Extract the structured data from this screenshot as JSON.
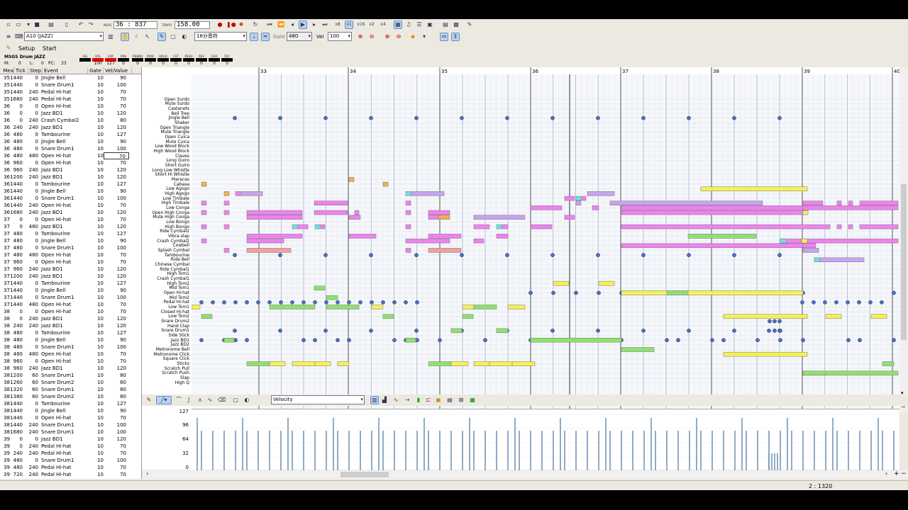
{
  "transport": {
    "meas_label": "MEAS",
    "position": "36 : 837",
    "tempo_label": "TEMPO",
    "tempo": "158.00",
    "zoom_x8": "x8",
    "zoom_x1": "x1",
    "zoom_x16": "x16",
    "zoom_x2": "x2",
    "zoom_x4": "x4"
  },
  "toolbar2": {
    "instrument": "A10 (JAZZ)",
    "grid": "16分音符",
    "gate_label": "Gate",
    "gate": "480",
    "vel_label": "Vel",
    "vel": "100"
  },
  "tabs": {
    "setup": "Setup",
    "start": "Start"
  },
  "mixer": {
    "track_name": "MSGS Drum JAZZ",
    "m_label": "M:",
    "m_value": "0",
    "l_label": "L:",
    "l_value": "0",
    "pc_label": "PC:",
    "pc_value": "33",
    "params": [
      {
        "label": "VEL",
        "value": ""
      },
      {
        "label": "VOL",
        "value": "100"
      },
      {
        "label": "EXP",
        "value": "127"
      },
      {
        "label": "PAN",
        "value": "0"
      },
      {
        "label": "P.BEND",
        "value": "0"
      },
      {
        "label": "MOD",
        "value": "0"
      },
      {
        "label": "HOLD",
        "value": "0"
      },
      {
        "label": "CUT",
        "value": "0"
      },
      {
        "label": "RESO",
        "value": "0"
      },
      {
        "label": "REV",
        "value": "0"
      },
      {
        "label": "CHO",
        "value": "0"
      },
      {
        "label": "DLY",
        "value": "0"
      }
    ]
  },
  "event_headers": [
    "Mea",
    "Tick",
    "Step",
    "Event",
    "Gate",
    "Vel/Value"
  ],
  "events": [
    [
      "35",
      "1440",
      "0",
      "Jingle Bell",
      "10",
      "90"
    ],
    [
      "35",
      "1440",
      "0",
      "Snare Drum1",
      "10",
      "100"
    ],
    [
      "35",
      "1440",
      "240",
      "Pedal Hi-hat",
      "10",
      "70"
    ],
    [
      "35",
      "1680",
      "240",
      "Pedal Hi-hat",
      "10",
      "70"
    ],
    [
      "36",
      "0",
      "0",
      "Open Hi-hat",
      "10",
      "70"
    ],
    [
      "36",
      "0",
      "0",
      "Jazz BD1",
      "10",
      "120"
    ],
    [
      "36",
      "0",
      "240",
      "Crash Cymbal2",
      "10",
      "80"
    ],
    [
      "36",
      "240",
      "240",
      "Jazz BD1",
      "10",
      "120"
    ],
    [
      "36",
      "480",
      "0",
      "Tambourine",
      "10",
      "127"
    ],
    [
      "36",
      "480",
      "0",
      "Jingle Bell",
      "10",
      "90"
    ],
    [
      "36",
      "480",
      "0",
      "Snare Drum1",
      "10",
      "100"
    ],
    [
      "36",
      "480",
      "480",
      "Open Hi-hat",
      "10",
      "70"
    ],
    [
      "36",
      "960",
      "0",
      "Open Hi-hat",
      "10",
      "70"
    ],
    [
      "36",
      "960",
      "240",
      "Jazz BD1",
      "10",
      "120"
    ],
    [
      "36",
      "1200",
      "240",
      "Jazz BD1",
      "10",
      "120"
    ],
    [
      "36",
      "1440",
      "0",
      "Tambourine",
      "10",
      "127"
    ],
    [
      "36",
      "1440",
      "0",
      "Jingle Bell",
      "10",
      "90"
    ],
    [
      "36",
      "1440",
      "0",
      "Snare Drum1",
      "10",
      "100"
    ],
    [
      "36",
      "1440",
      "240",
      "Open Hi-hat",
      "10",
      "70"
    ],
    [
      "36",
      "1680",
      "240",
      "Jazz BD1",
      "10",
      "120"
    ],
    [
      "37",
      "0",
      "0",
      "Open Hi-hat",
      "10",
      "70"
    ],
    [
      "37",
      "0",
      "480",
      "Jazz BD1",
      "10",
      "120"
    ],
    [
      "37",
      "480",
      "0",
      "Tambourine",
      "10",
      "127"
    ],
    [
      "37",
      "480",
      "0",
      "Jingle Bell",
      "10",
      "90"
    ],
    [
      "37",
      "480",
      "0",
      "Snare Drum1",
      "10",
      "100"
    ],
    [
      "37",
      "480",
      "480",
      "Open Hi-hat",
      "10",
      "70"
    ],
    [
      "37",
      "960",
      "0",
      "Open Hi-hat",
      "10",
      "70"
    ],
    [
      "37",
      "960",
      "240",
      "Jazz BD1",
      "10",
      "120"
    ],
    [
      "37",
      "1200",
      "240",
      "Jazz BD1",
      "10",
      "120"
    ],
    [
      "37",
      "1440",
      "0",
      "Tambourine",
      "10",
      "127"
    ],
    [
      "37",
      "1440",
      "0",
      "Jingle Bell",
      "10",
      "90"
    ],
    [
      "37",
      "1440",
      "0",
      "Snare Drum1",
      "10",
      "100"
    ],
    [
      "37",
      "1440",
      "480",
      "Open Hi-hat",
      "10",
      "70"
    ],
    [
      "38",
      "0",
      "0",
      "Open Hi-hat",
      "10",
      "70"
    ],
    [
      "38",
      "0",
      "240",
      "Jazz BD1",
      "10",
      "120"
    ],
    [
      "38",
      "240",
      "240",
      "Jazz BD1",
      "10",
      "120"
    ],
    [
      "38",
      "480",
      "0",
      "Tambourine",
      "10",
      "127"
    ],
    [
      "38",
      "480",
      "0",
      "Jingle Bell",
      "10",
      "90"
    ],
    [
      "38",
      "480",
      "0",
      "Snare Drum1",
      "10",
      "100"
    ],
    [
      "38",
      "480",
      "480",
      "Open Hi-hat",
      "10",
      "70"
    ],
    [
      "38",
      "960",
      "0",
      "Open Hi-hat",
      "10",
      "70"
    ],
    [
      "38",
      "960",
      "240",
      "Jazz BD1",
      "10",
      "120"
    ],
    [
      "38",
      "1200",
      "60",
      "Snare Drum1",
      "10",
      "80"
    ],
    [
      "38",
      "1260",
      "60",
      "Snare Drum2",
      "10",
      "80"
    ],
    [
      "38",
      "1320",
      "60",
      "Snare Drum1",
      "10",
      "80"
    ],
    [
      "38",
      "1380",
      "60",
      "Snare Drum2",
      "10",
      "80"
    ],
    [
      "38",
      "1440",
      "0",
      "Tambourine",
      "10",
      "127"
    ],
    [
      "38",
      "1440",
      "0",
      "Jingle Bell",
      "10",
      "90"
    ],
    [
      "38",
      "1440",
      "0",
      "Open Hi-hat",
      "10",
      "70"
    ],
    [
      "38",
      "1440",
      "240",
      "Snare Drum1",
      "10",
      "100"
    ],
    [
      "38",
      "1680",
      "240",
      "Snare Drum1",
      "10",
      "100"
    ],
    [
      "39",
      "0",
      "0",
      "Jazz BD1",
      "10",
      "120"
    ],
    [
      "39",
      "0",
      "240",
      "Pedal Hi-hat",
      "10",
      "70"
    ],
    [
      "39",
      "240",
      "240",
      "Pedal Hi-hat",
      "10",
      "70"
    ],
    [
      "39",
      "480",
      "0",
      "Snare Drum1",
      "10",
      "100"
    ],
    [
      "39",
      "480",
      "240",
      "Pedal Hi-hat",
      "10",
      "70"
    ],
    [
      "39",
      "720",
      "240",
      "Pedal Hi-hat",
      "10",
      "70"
    ]
  ],
  "drum_names": [
    "Open Surdo",
    "Mute Surdo",
    "Castanets",
    "Bell Tree",
    "Jingle Bell",
    "Shaker",
    "Open Triangle",
    "Mute Triangle",
    "Open Cuica",
    "Mute Cuica",
    "Low Wood Block",
    "High Wood Block",
    "Claves",
    "Long Guiro",
    "Short Guiro",
    "Long Low Whistle",
    "Short Hi Whistle",
    "Maracas",
    "Cabasa",
    "Low Agogo",
    "High Agogo",
    "Low Timbale",
    "High Timbale",
    "Low Conga",
    "Open High Conga",
    "Mute High Conga",
    "Low Bongo",
    "High Bongo",
    "Ride Cymbal2",
    "Vibra-slap",
    "Crash Cymbal2",
    "Cowbell",
    "Splash Cymbal",
    "Tambourine",
    "Ride Bell",
    "Chinese Cymbal",
    "Ride Cymbal1",
    "High Tom1",
    "Crash Cymbal1",
    "High Tom2",
    "Mid Tom1",
    "Open Hi-hat",
    "Mid Tom2",
    "Pedal Hi-hat",
    "Low Tom1",
    "Closed Hi-hat",
    "Low Tom2",
    "Snare Drum2",
    "Hand Clap",
    "Snare Drum1",
    "Side Stick",
    "Jazz BD1",
    "Jazz BD2",
    "Metronome Bell",
    "Metronome Click",
    "Square Click",
    "Sticks",
    "Scratch Pull",
    "Scratch Push",
    "Slap",
    "High Q"
  ],
  "measures": [
    "33",
    "34",
    "35",
    "36",
    "37",
    "38",
    "39",
    "40"
  ],
  "control": {
    "type": "Velocity",
    "axis": [
      "127",
      "96",
      "64",
      "32",
      "0"
    ]
  },
  "status": {
    "position": "2 : 1320"
  },
  "colors": {
    "note_pink": "#ee82ee",
    "note_yellow": "#f5f05a",
    "note_green": "#90e070",
    "note_blue_dot": "#4a6fc8",
    "note_lilac": "#c7a3ee"
  }
}
